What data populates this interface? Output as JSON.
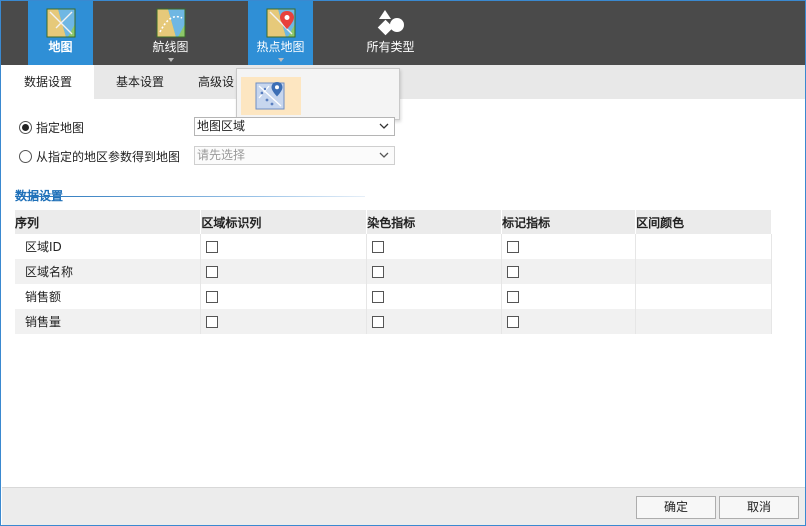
{
  "types": [
    {
      "label": "地图",
      "icon": "map-icon",
      "active": true
    },
    {
      "label": "航线图",
      "icon": "route-map-icon",
      "active": false
    },
    {
      "label": "热点地图",
      "icon": "hot-spot-map-icon",
      "active": true
    },
    {
      "label": "所有类型",
      "icon": "all-types-icon",
      "active": false
    }
  ],
  "tabs": [
    {
      "label": "数据设置",
      "active": true
    },
    {
      "label": "基本设置",
      "active": false
    },
    {
      "label": "高级设",
      "active": false
    }
  ],
  "popup": {
    "items": [
      {
        "icon": "hot-spot-scatter-map-icon",
        "selected": true
      }
    ]
  },
  "options": {
    "specified_map": {
      "label": "指定地图",
      "checked": true,
      "select_value": "地图区域"
    },
    "from_region_param": {
      "label": "从指定的地区参数得到地图",
      "checked": false,
      "select_placeholder": "请先选择"
    }
  },
  "section": {
    "title": "数据设置"
  },
  "table": {
    "headers": [
      "序列",
      "区域标识列",
      "染色指标",
      "标记指标",
      "区间颜色"
    ],
    "rows": [
      {
        "name": "区域ID",
        "region_id": false,
        "color_metric": false,
        "mark_metric": false
      },
      {
        "name": "区域名称",
        "region_id": false,
        "color_metric": false,
        "mark_metric": false
      },
      {
        "name": "销售额",
        "region_id": false,
        "color_metric": false,
        "mark_metric": false
      },
      {
        "name": "销售量",
        "region_id": false,
        "color_metric": false,
        "mark_metric": false
      }
    ]
  },
  "footer": {
    "ok": "确定",
    "cancel": "取消"
  },
  "colors": {
    "accent": "#2f8fd6",
    "toolbar": "#4a4a4a",
    "section": "#1d6fb8",
    "selected": "#fde6c1"
  }
}
